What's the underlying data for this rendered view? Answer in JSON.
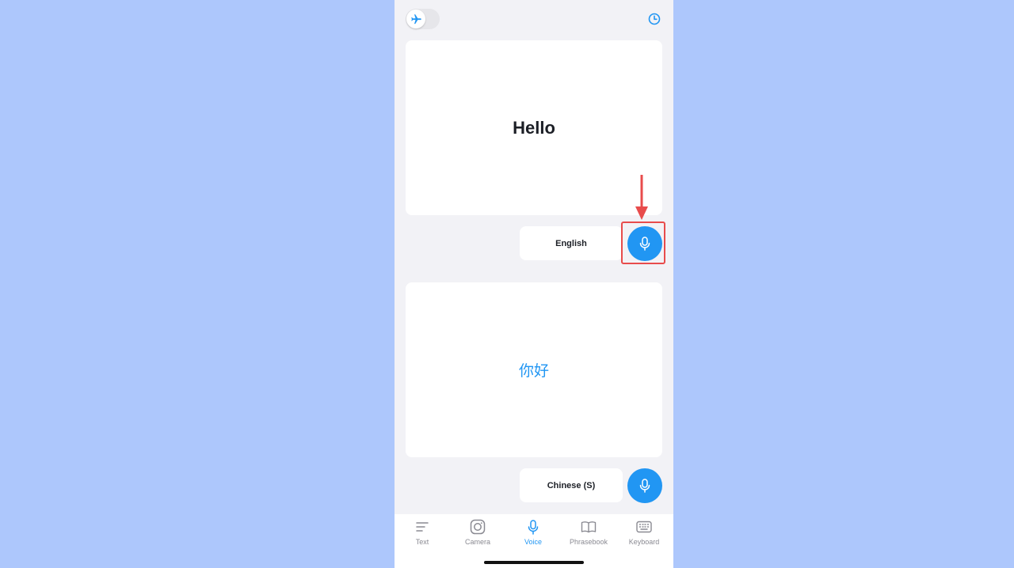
{
  "source": {
    "text": "Hello",
    "language": "English"
  },
  "target": {
    "text": "你好",
    "language": "Chinese (S)"
  },
  "tabs": [
    {
      "label": "Text",
      "icon": "text-lines-icon",
      "active": false
    },
    {
      "label": "Camera",
      "icon": "camera-icon",
      "active": false
    },
    {
      "label": "Voice",
      "icon": "microphone-icon",
      "active": true
    },
    {
      "label": "Phrasebook",
      "icon": "book-icon",
      "active": false
    },
    {
      "label": "Keyboard",
      "icon": "keyboard-icon",
      "active": false
    }
  ],
  "colors": {
    "accent": "#2196f3",
    "annotation": "#e84c4c",
    "background": "#adc7fc"
  }
}
